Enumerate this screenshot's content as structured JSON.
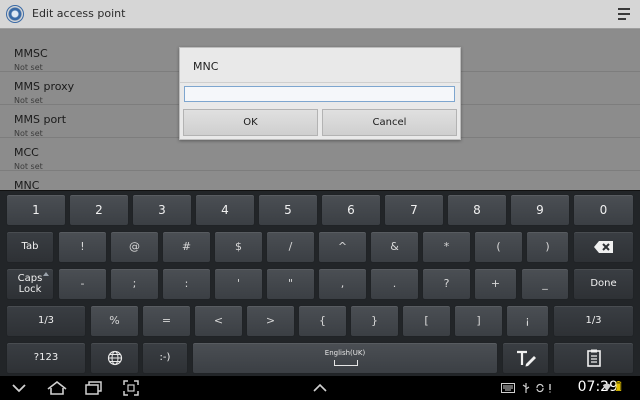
{
  "action_bar": {
    "title": "Edit access point",
    "app_icon": "settings-gear-icon",
    "menu_icon": "overflow-menu-icon"
  },
  "settings_list": [
    {
      "title": "MMSC",
      "subtitle": "Not set"
    },
    {
      "title": "MMS proxy",
      "subtitle": "Not set"
    },
    {
      "title": "MMS port",
      "subtitle": "Not set"
    },
    {
      "title": "MCC",
      "subtitle": "Not set"
    },
    {
      "title": "MNC",
      "subtitle": ""
    }
  ],
  "dialog": {
    "title": "MNC",
    "input_value": "",
    "ok_label": "OK",
    "cancel_label": "Cancel"
  },
  "keyboard": {
    "row1": [
      "1",
      "2",
      "3",
      "4",
      "5",
      "6",
      "7",
      "8",
      "9",
      "0"
    ],
    "tab_label": "Tab",
    "row2": [
      "!",
      "@",
      "#",
      "$",
      "/",
      "^",
      "&",
      "*",
      "(",
      ")"
    ],
    "backspace_icon": "backspace-icon",
    "caps_line1": "Caps",
    "caps_line2": "Lock",
    "row3": [
      "-",
      ";",
      ":",
      "'",
      "\"",
      ",",
      ".",
      "?",
      "+",
      "_"
    ],
    "done_label": "Done",
    "page_left": "1/3",
    "row4": [
      "%",
      "=",
      "<",
      ">",
      "{",
      "}",
      "[",
      "]",
      "¡"
    ],
    "page_right": "1/3",
    "mode_label": "?123",
    "globe_icon": "globe-icon",
    "emoticon_label": ":-)",
    "space_label": "English(UK)",
    "handwriting_icon": "handwriting-icon",
    "clipboard_icon": "clipboard-icon"
  },
  "nav_bar": {
    "time": "07:29",
    "back_icon": "back-chevron-icon",
    "home_icon": "home-icon",
    "recents_icon": "recent-apps-icon",
    "screenshot_icon": "screenshot-icon",
    "up_icon": "chevron-up-icon",
    "keyboard_status_icon": "keyboard-icon",
    "usb_icon": "usb-icon",
    "wifi_icon": "wifi-icon",
    "battery_icon": "battery-icon",
    "accent_color": "#3a6aa6"
  }
}
